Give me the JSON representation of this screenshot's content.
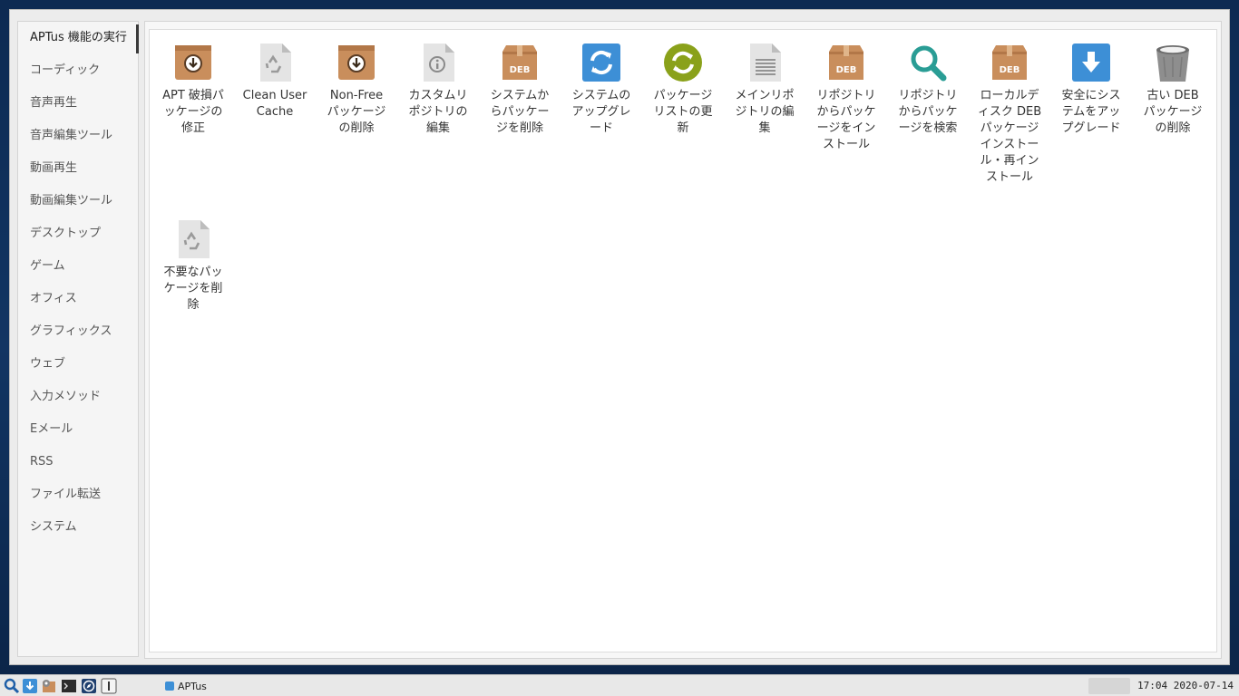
{
  "sidebar": {
    "items": [
      {
        "label": "APTus 機能の実行",
        "active": true
      },
      {
        "label": "コーディック"
      },
      {
        "label": "音声再生"
      },
      {
        "label": "音声編集ツール"
      },
      {
        "label": "動画再生"
      },
      {
        "label": "動画編集ツール"
      },
      {
        "label": "デスクトップ"
      },
      {
        "label": "ゲーム"
      },
      {
        "label": "オフィス"
      },
      {
        "label": "グラフィックス"
      },
      {
        "label": "ウェブ"
      },
      {
        "label": "入力メソッド"
      },
      {
        "label": "Eメール"
      },
      {
        "label": "RSS"
      },
      {
        "label": "ファイル転送"
      },
      {
        "label": "システム"
      }
    ]
  },
  "apps": [
    {
      "label": "APT 破損パッケージの修正",
      "icon": "package-fix-icon"
    },
    {
      "label": "Clean User Cache",
      "icon": "recycle-file-icon"
    },
    {
      "label": "Non-Free パッケージの削除",
      "icon": "package-remove-icon"
    },
    {
      "label": "カスタムリポジトリの編集",
      "icon": "info-file-icon"
    },
    {
      "label": "システムからパッケージを削除",
      "icon": "deb-package-icon"
    },
    {
      "label": "システムのアップグレード",
      "icon": "refresh-icon"
    },
    {
      "label": "パッケージリストの更新",
      "icon": "sync-icon"
    },
    {
      "label": "メインリポジトリの編集",
      "icon": "text-file-icon"
    },
    {
      "label": "リポジトリからパッケージをインストール",
      "icon": "deb-package-icon"
    },
    {
      "label": "リポジトリからパッケージを検索",
      "icon": "search-icon"
    },
    {
      "label": "ローカルディスク DEB パッケージ インストール・再インストール",
      "icon": "deb-package-icon"
    },
    {
      "label": "安全にシステムをアップグレード",
      "icon": "download-icon"
    },
    {
      "label": "古い DEB パッケージの削除",
      "icon": "trash-icon"
    },
    {
      "label": "不要なパッケージを削除",
      "icon": "recycle-file-icon"
    }
  ],
  "taskbar": {
    "task_label": "APTus",
    "clock": "17:04  2020-07-14",
    "launchers": [
      "search-icon",
      "download-icon",
      "package-manager-icon",
      "terminal-icon",
      "browser-icon",
      "info-icon"
    ]
  },
  "colors": {
    "desktop": "#123563",
    "package_brown": "#c98e5c",
    "refresh_blue": "#3d8fd6",
    "sync_green": "#8aa11a",
    "search_teal": "#2a9d95"
  }
}
